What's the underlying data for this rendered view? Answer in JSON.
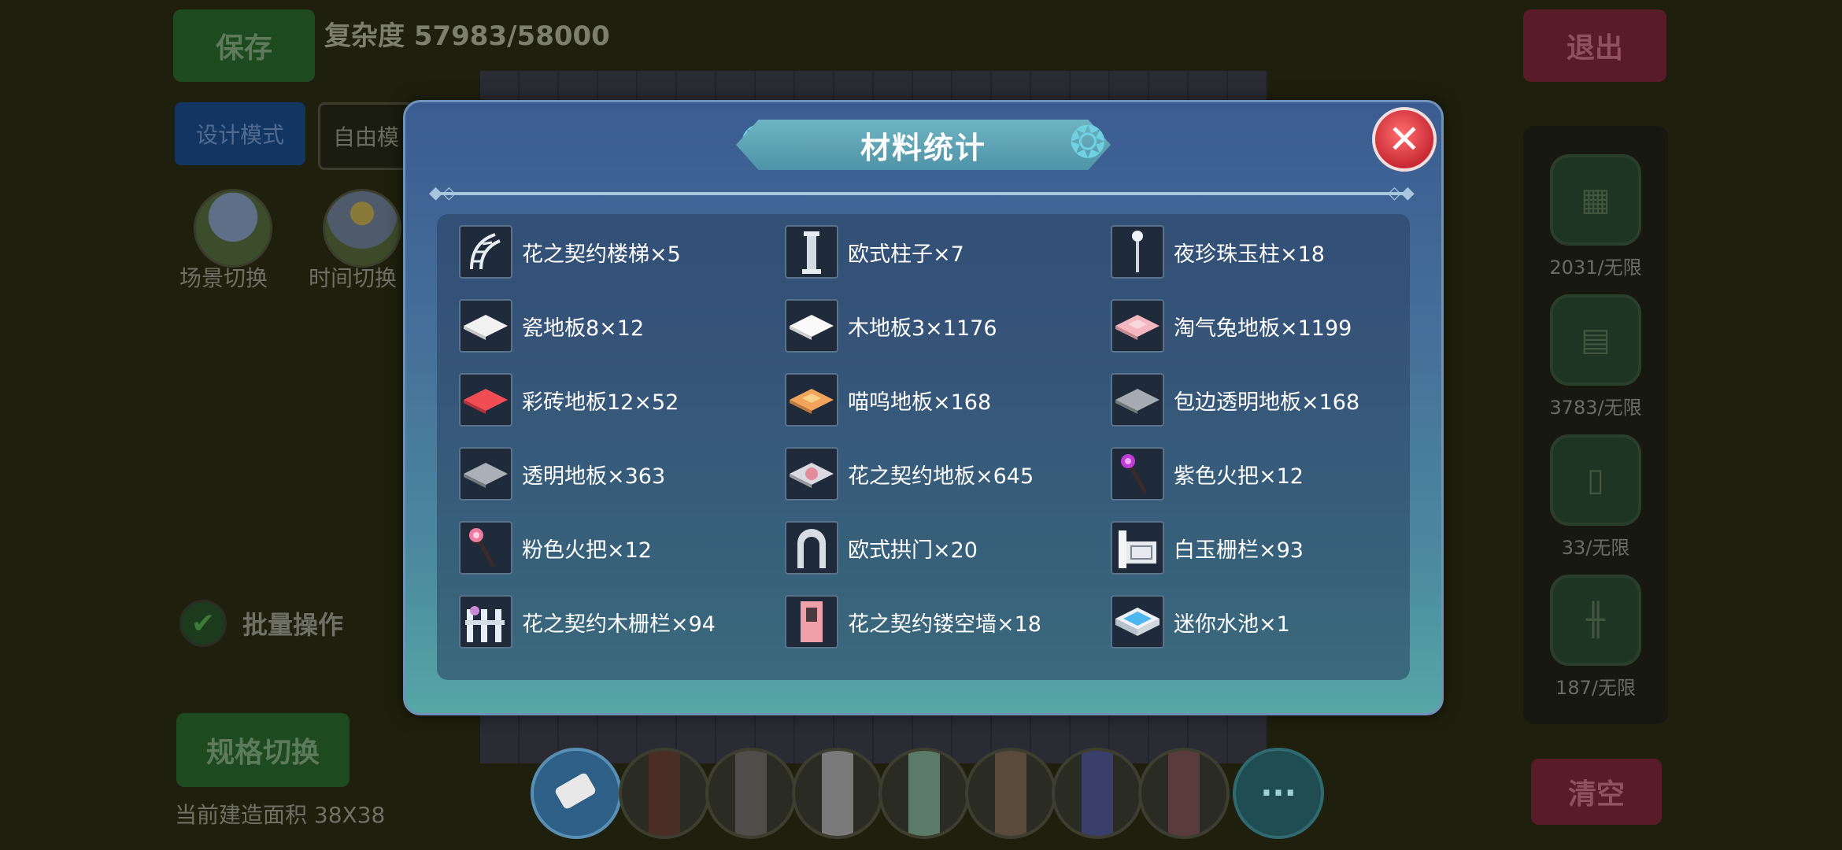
{
  "header": {
    "save_label": "保存",
    "complexity": "复杂度 57983/58000",
    "exit_label": "退出"
  },
  "modes": {
    "design": "设计模式",
    "free": "自由模"
  },
  "scene_buttons": {
    "scene_switch": "场景切换",
    "time_switch": "时间切换"
  },
  "batch_label": "批量操作",
  "spec_switch_label": "规格切换",
  "area_text": "当前建造面积 38X38",
  "clear_label": "清空",
  "right_panel": {
    "items": [
      {
        "count": "2031/无限",
        "icon": "brick-block-icon"
      },
      {
        "count": "3783/无限",
        "icon": "stone-wall-icon"
      },
      {
        "count": "33/无限",
        "icon": "door-icon"
      },
      {
        "count": "187/无限",
        "icon": "fence-icon"
      }
    ]
  },
  "toolbar": {
    "more_label": "···"
  },
  "dialog": {
    "title": "材料统计",
    "close_label": "✕",
    "items": [
      {
        "label": "花之契约楼梯×5",
        "icon": "stairs-icon"
      },
      {
        "label": "欧式柱子×7",
        "icon": "pillar-icon"
      },
      {
        "label": "夜珍珠玉柱×18",
        "icon": "lamp-pillar-icon"
      },
      {
        "label": "瓷地板8×12",
        "icon": "white-floor-icon"
      },
      {
        "label": "木地板3×1176",
        "icon": "white-floor-icon"
      },
      {
        "label": "淘气兔地板×1199",
        "icon": "pink-floor-icon"
      },
      {
        "label": "彩砖地板12×52",
        "icon": "red-floor-icon"
      },
      {
        "label": "喵呜地板×168",
        "icon": "orange-floor-icon"
      },
      {
        "label": "包边透明地板×168",
        "icon": "gray-floor-icon"
      },
      {
        "label": "透明地板×363",
        "icon": "gray-floor-icon"
      },
      {
        "label": "花之契约地板×645",
        "icon": "flower-floor-icon"
      },
      {
        "label": "紫色火把×12",
        "icon": "purple-torch-icon"
      },
      {
        "label": "粉色火把×12",
        "icon": "pink-torch-icon"
      },
      {
        "label": "欧式拱门×20",
        "icon": "arch-icon"
      },
      {
        "label": "白玉栅栏×93",
        "icon": "jade-fence-icon"
      },
      {
        "label": "花之契约木栅栏×94",
        "icon": "wood-fence-icon"
      },
      {
        "label": "花之契约镂空墙×18",
        "icon": "hollow-wall-icon"
      },
      {
        "label": "迷你水池×1",
        "icon": "pool-icon"
      }
    ]
  }
}
